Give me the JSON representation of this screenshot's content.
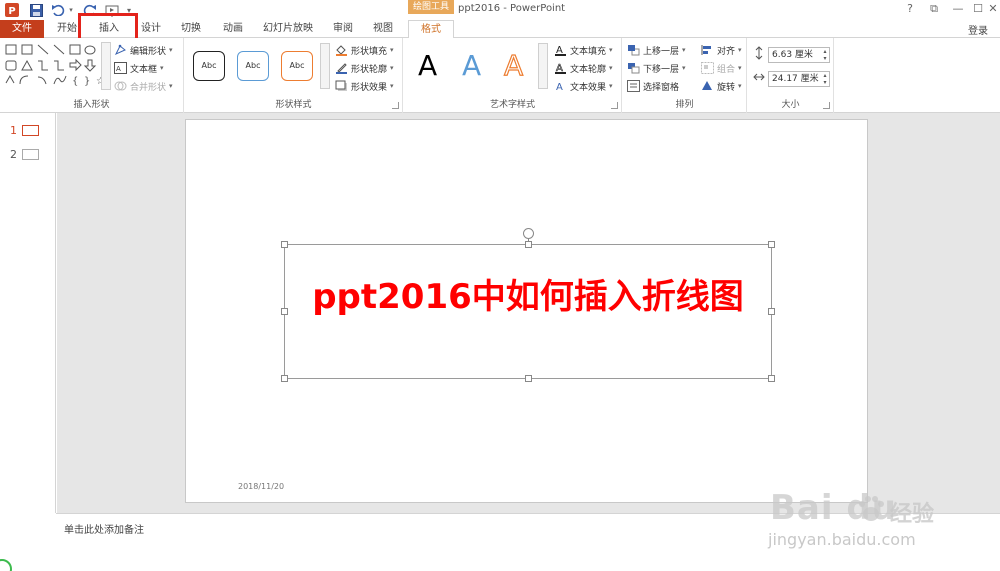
{
  "titlebar": {
    "context_tab_label": "绘图工具",
    "doc_title": "ppt2016 - PowerPoint",
    "help": "?",
    "ribbon_options": "⧉",
    "minimize": "—",
    "maximize": "☐",
    "close": "✕"
  },
  "tabs": [
    "文件",
    "开始",
    "插入",
    "设计",
    "切换",
    "动画",
    "幻灯片放映",
    "审阅",
    "视图",
    "格式"
  ],
  "login": "登录",
  "ribbon": {
    "insert_shapes": {
      "label": "插入形状",
      "edit_shape": "编辑形状",
      "text_box": "文本框",
      "merge_shapes": "合并形状"
    },
    "shape_styles": {
      "label": "形状样式",
      "styles": [
        "Abc",
        "Abc",
        "Abc"
      ],
      "fill": "形状填充",
      "outline": "形状轮廓",
      "effects": "形状效果"
    },
    "wordart": {
      "label": "艺术字样式",
      "letters": [
        "A",
        "A",
        "A"
      ],
      "text_fill": "文本填充",
      "text_outline": "文本轮廓",
      "text_effects": "文本效果"
    },
    "arrange": {
      "label": "排列",
      "bring_forward": "上移一层",
      "send_backward": "下移一层",
      "selection_pane": "选择窗格",
      "align": "对齐",
      "group": "组合",
      "rotate": "旋转"
    },
    "size": {
      "label": "大小",
      "height": "6.63 厘米",
      "width": "24.17 厘米"
    }
  },
  "thumbnails": [
    {
      "num": "1"
    },
    {
      "num": "2"
    }
  ],
  "slide": {
    "title": "ppt2016中如何插入折线图",
    "date": "2018/11/20"
  },
  "notes_placeholder": "单击此处添加备注",
  "watermark": {
    "brand": "Bai du",
    "cn": "经验",
    "url": "jingyan.baidu.com"
  },
  "colors": {
    "file_tab": "#c43e1c",
    "context_tab": "#e8a85a",
    "highlight": "#e3231b",
    "title_text": "#ff0000",
    "selected_thumb": "#d24726"
  },
  "icons": [
    "powerpoint-logo-icon",
    "save-icon",
    "undo-icon",
    "redo-icon",
    "start-from-beginning-icon",
    "customize-qat-icon"
  ]
}
